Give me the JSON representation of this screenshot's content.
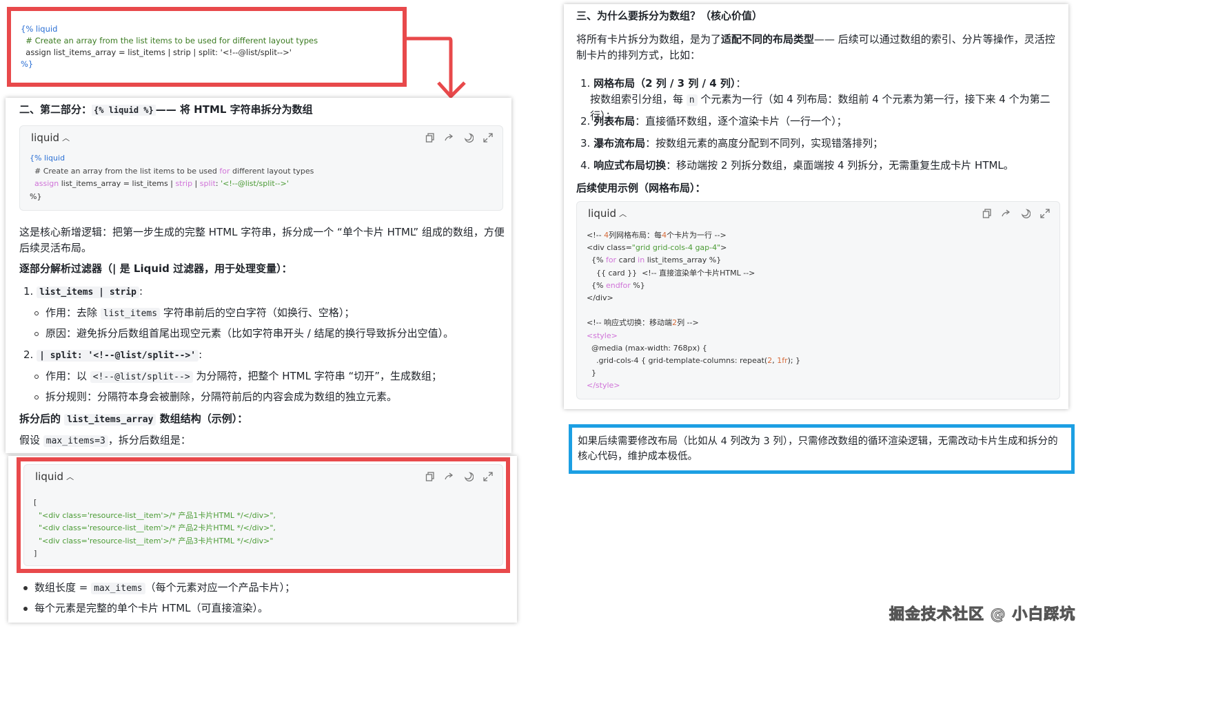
{
  "top_red_code": [
    "{% liquid",
    "  # Create an array from the list items to be used for different layout types",
    "  assign list_items_array = list_items | strip | split: '<!--@list/split-->'",
    "%}"
  ],
  "left": {
    "heading_prefix": "二、第二部分：",
    "heading_code": "{% liquid %}",
    "heading_suffix": "—— 将 HTML 字符串拆分为数组",
    "code1_lang": "liquid",
    "code1": {
      "l1": "{% liquid",
      "l2a": "  # Create an array from the list items to be used ",
      "l2b": "for",
      "l2c": " different layout types",
      "l3a": "  assign",
      "l3b": " list_items_array = list_items | ",
      "l3c": "strip",
      "l3d": " | ",
      "l3e": "split",
      "l3f": ": ",
      "l3g": "'<!--@list/split-->'",
      "l4": "%}"
    },
    "para1": "这是核心新增逻辑：把第一步生成的完整 HTML 字符串，拆分成一个 “单个卡片 HTML” 组成的数组，方便后续灵活布局。",
    "h2": "逐部分解析过滤器（| 是 Liquid 过滤器，用于处理变量）：",
    "item1_num": "1.",
    "item1_code": "list_items | strip",
    "item1_colon": ":",
    "b1_a": "作用：去除 ",
    "b1_code": "list_items",
    "b1_b": " 字符串前后的空白字符（如换行、空格）；",
    "b2": "原因：避免拆分后数组首尾出现空元素（比如字符串开头 / 结尾的换行导致拆分出空值）。",
    "item2_num": "2.",
    "item2_code": "| split: '<!--@list/split-->'",
    "item2_colon": ":",
    "b3_a": "作用：以 ",
    "b3_code": "<!--@list/split-->",
    "b3_b": " 为分隔符，把整个 HTML 字符串 “切开”，生成数组；",
    "b4": "拆分规则：分隔符本身会被删除，分隔符前后的内容会成为数组的独立元素。",
    "h3_a": "拆分后的 ",
    "h3_code": "list_items_array",
    "h3_b": " 数组结构（示例）：",
    "para2_a": "假设 ",
    "para2_code": "max_items=3",
    "para2_b": "，拆分后数组是：",
    "code2_lang": "liquid",
    "code2": [
      "[",
      "  \"<div class='resource-list__item'>/* 产品1卡片HTML */</div>\",",
      "  \"<div class='resource-list__item'>/* 产品2卡片HTML */</div>\",",
      "  \"<div class='resource-list__item'>/* 产品3卡片HTML */</div>\"",
      "]"
    ],
    "f1_a": "数组长度 = ",
    "f1_code": "max_items",
    "f1_b": "（每个元素对应一个产品卡片）；",
    "f2": "每个元素是完整的单个卡片 HTML（可直接渲染）。"
  },
  "right": {
    "heading": "三、为什么要拆分为数组？（核心价值）",
    "para1_a": "将所有卡片拆分为数组，是为了",
    "para1_b": "适配不同的布局类型",
    "para1_c": "—— 后续可以通过数组的索引、分片等操作，灵活控制卡片的排列方式，比如：",
    "l1_num": "1.",
    "l1_title": "网格布局（2 列 / 3 列 / 4 列）",
    "l1_colon": "：",
    "l1_desc_a": "按数组索引分组，每 ",
    "l1_code": "n",
    "l1_desc_b": " 个元素为一行（如 4 列布局：数组前 4 个元素为第一行，接下来 4 个为第二行）；",
    "l2_num": "2.",
    "l2_title": "列表布局",
    "l2_desc": "：直接循环数组，逐个渲染卡片（一行一个）；",
    "l3_num": "3.",
    "l3_title": "瀑布流布局",
    "l3_desc": "：按数组元素的高度分配到不同列，实现错落排列；",
    "l4_num": "4.",
    "l4_title": "响应式布局切换",
    "l4_desc": "：移动端按 2 列拆分数组，桌面端按 4 列拆分，无需重复生成卡片 HTML。",
    "h2": "后续使用示例（网格布局）：",
    "code_lang": "liquid",
    "code": {
      "c1a": "<!-- ",
      "c1b": "4",
      "c1c": "列网格布局：每",
      "c1d": "4",
      "c1e": "个卡片为一行 -->",
      "c2a": "<div class=",
      "c2b": "\"grid grid-cols-4 gap-4\"",
      "c2c": ">",
      "c3a": "  {% ",
      "c3b": "for",
      "c3c": " card ",
      "c3d": "in",
      "c3e": " list_items_array %}",
      "c4": "    {{ card }}  <!-- 直接渲染单个卡片HTML -->",
      "c5a": "  {% ",
      "c5b": "endfor",
      "c5c": " %}",
      "c6": "</div>",
      "c7a": "<!-- 响应式切换：移动端",
      "c7b": "2",
      "c7c": "列 -->",
      "c8": "<style>",
      "c9": "  @media (max-width: 768px) {",
      "c10a": "    .grid-cols-4 { grid-template-columns: repeat(",
      "c10b": "2",
      "c10c": ", ",
      "c10d": "1fr",
      "c10e": "); }",
      "c11": "  }",
      "c12": "</style>"
    }
  },
  "blue_note": "如果后续需要修改布局（比如从 4 列改为 3 列），只需修改数组的循环渲染逻辑，无需改动卡片生成和拆分的核心代码，维护成本极低。",
  "watermark": "掘金技术社区 @ 小白踩坑",
  "colors": {
    "red": "#e8494b",
    "blue": "#1c9fe3"
  }
}
